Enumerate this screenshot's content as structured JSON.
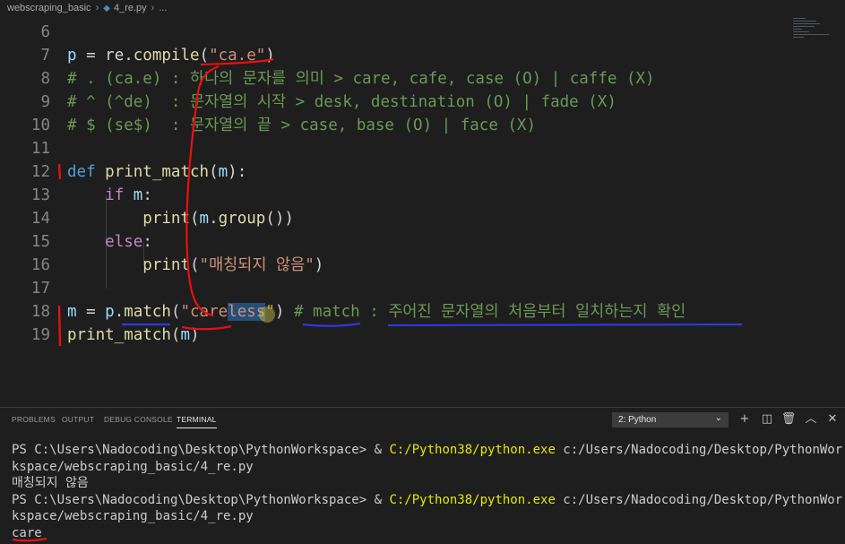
{
  "breadcrumb": {
    "folder": "webscraping_basic",
    "file": "4_re.py",
    "more": "..."
  },
  "editor": {
    "lines": [
      {
        "n": "6"
      },
      {
        "n": "7",
        "var": "p",
        "op": " = re.",
        "fn": "compile",
        "open": "(",
        "str": "\"ca.e\"",
        "close": ")"
      },
      {
        "n": "8",
        "comment": "# . (ca.e) : 하나의 문자를 의미 > care, cafe, case (O) | caffe (X)"
      },
      {
        "n": "9",
        "comment": "# ^ (^de)  : 문자열의 시작 > desk, destination (O) | fade (X)"
      },
      {
        "n": "10",
        "comment": "# $ (se$)  : 문자열의 끝 > case, base (O) | face (X)"
      },
      {
        "n": "11"
      },
      {
        "n": "12",
        "kw": "def",
        "fn": "print_match",
        "open": "(",
        "param": "m",
        "close": "):"
      },
      {
        "n": "13",
        "kw": "if",
        "var": "m",
        "close": ":"
      },
      {
        "n": "14",
        "fn": "print",
        "open": "(",
        "var": "m",
        "mid": ".",
        "fn2": "group",
        "close": "())"
      },
      {
        "n": "15",
        "kw": "else",
        "close": ":"
      },
      {
        "n": "16",
        "fn": "print",
        "open": "(",
        "str": "\"매칭되지 않음\"",
        "close": ")"
      },
      {
        "n": "17"
      },
      {
        "n": "18",
        "var": "m",
        "op": " = ",
        "var2": "p",
        "dot": ".",
        "fn": "match",
        "open": "(",
        "str_a": "\"care",
        "str_b": "less",
        "str_c": "\"",
        "close": ")",
        "comment": " # match : 주어진 문자열의 처음부터 일치하는지 확인"
      },
      {
        "n": "19",
        "fn": "print_match",
        "open": "(",
        "var": "m",
        "close": ")"
      }
    ]
  },
  "panel": {
    "tabs": [
      "PROBLEMS",
      "OUTPUT",
      "DEBUG CONSOLE",
      "TERMINAL"
    ],
    "active_tab": "TERMINAL",
    "terminal_select": "2: Python",
    "terminal": {
      "prompt": "PS C:\\Users\\Nadocoding\\Desktop\\PythonWorkspace> & ",
      "exe": "C:/Python38/python.exe",
      "arg_a": " c:/Users/Nadocoding/Desktop/PythonWor",
      "arg_b": "kspace/webscraping_basic/4_re.py",
      "out1": "매칭되지 않음",
      "out2": "care"
    }
  }
}
